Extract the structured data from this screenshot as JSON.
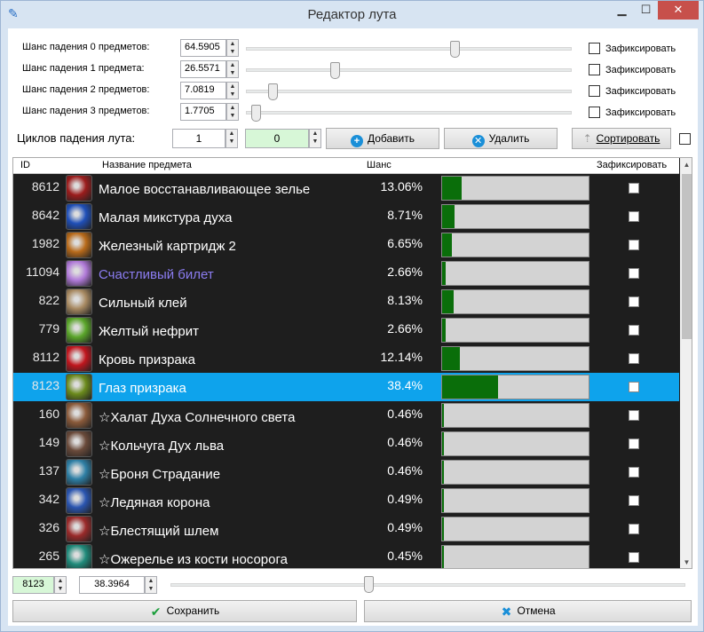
{
  "window": {
    "title": "Редактор лута"
  },
  "chances": [
    {
      "label": "Шанс падения 0 предметов:",
      "value": "64.5905",
      "slider_fraction": 0.645,
      "fix_label": "Зафиксировать"
    },
    {
      "label": "Шанс падения 1 предмета:",
      "value": "26.5571",
      "slider_fraction": 0.266,
      "fix_label": "Зафиксировать"
    },
    {
      "label": "Шанс падения 2 предметов:",
      "value": "7.0819",
      "slider_fraction": 0.071,
      "fix_label": "Зафиксировать"
    },
    {
      "label": "Шанс падения 3 предметов:",
      "value": "1.7705",
      "slider_fraction": 0.018,
      "fix_label": "Зафиксировать"
    }
  ],
  "cycles": {
    "label": "Циклов падения лута:",
    "value": "1",
    "item_value": "0"
  },
  "toolbar": {
    "add_label": "Добавить",
    "remove_label": "Удалить",
    "sort_label": "Сортировать"
  },
  "table": {
    "columns": {
      "id": "ID",
      "name": "Название предмета",
      "chance": "Шанс",
      "fixed": "Зафиксировать"
    },
    "rows": [
      {
        "id": "8612",
        "name": "Малое восстанавливающее зелье",
        "chance": "13.06%",
        "fraction": 0.1306,
        "name_color": "#ffffff",
        "icon_color": "#9b1c1c"
      },
      {
        "id": "8642",
        "name": "Малая микстура духа",
        "chance": "8.71%",
        "fraction": 0.0871,
        "name_color": "#ffffff",
        "icon_color": "#1f4fb8"
      },
      {
        "id": "1982",
        "name": "Железный картридж 2",
        "chance": "6.65%",
        "fraction": 0.0665,
        "name_color": "#ffffff",
        "icon_color": "#b86a1a"
      },
      {
        "id": "11094",
        "name": "Счастливый билет",
        "chance": "2.66%",
        "fraction": 0.0266,
        "name_color": "#8b7cf0",
        "icon_color": "#b07ad8"
      },
      {
        "id": "822",
        "name": "Сильный клей",
        "chance": "8.13%",
        "fraction": 0.0813,
        "name_color": "#ffffff",
        "icon_color": "#a88a62"
      },
      {
        "id": "779",
        "name": "Желтый нефрит",
        "chance": "2.66%",
        "fraction": 0.0266,
        "name_color": "#ffffff",
        "icon_color": "#5aa52a"
      },
      {
        "id": "8112",
        "name": "Кровь призрака",
        "chance": "12.14%",
        "fraction": 0.1214,
        "name_color": "#ffffff",
        "icon_color": "#c0161e"
      },
      {
        "id": "8123",
        "name": "Глаз призрака",
        "chance": "38.4%",
        "fraction": 0.384,
        "name_color": "#ffffff",
        "icon_color": "#6b8a1c",
        "selected": true
      },
      {
        "id": "160",
        "name": "☆Халат Духа Солнечного света",
        "chance": "0.46%",
        "fraction": 0.0046,
        "name_color": "#ffffff",
        "icon_color": "#8a5a3a"
      },
      {
        "id": "149",
        "name": "☆Кольчуга Дух льва",
        "chance": "0.46%",
        "fraction": 0.0046,
        "name_color": "#ffffff",
        "icon_color": "#6a4a3a"
      },
      {
        "id": "137",
        "name": "☆Броня Страдание",
        "chance": "0.46%",
        "fraction": 0.0046,
        "name_color": "#ffffff",
        "icon_color": "#2e7fa5"
      },
      {
        "id": "342",
        "name": "☆Ледяная корона",
        "chance": "0.49%",
        "fraction": 0.0049,
        "name_color": "#ffffff",
        "icon_color": "#2a55b0"
      },
      {
        "id": "326",
        "name": "☆Блестящий шлем",
        "chance": "0.49%",
        "fraction": 0.0049,
        "name_color": "#ffffff",
        "icon_color": "#9a2a2a"
      },
      {
        "id": "265",
        "name": "☆Ожерелье из кости носорога",
        "chance": "0.45%",
        "fraction": 0.0045,
        "name_color": "#ffffff",
        "icon_color": "#1f8a7a"
      }
    ]
  },
  "selected_editor": {
    "id_value": "8123",
    "chance_value": "38.3964",
    "slider_fraction": 0.384
  },
  "footer": {
    "save_label": "Сохранить",
    "cancel_label": "Отмена"
  },
  "colors": {
    "accent_selected": "#0ea3ec",
    "bar_fill": "#0a6e0a",
    "grid_bg": "#1e1e1e",
    "close_btn": "#c7504b",
    "add_icon": "#1a8fd8",
    "remove_icon": "#1a8fd8",
    "save_icon": "#1a9e3a",
    "cancel_icon": "#1a8fd8",
    "cycles_highlight": "#d7f7d7"
  }
}
